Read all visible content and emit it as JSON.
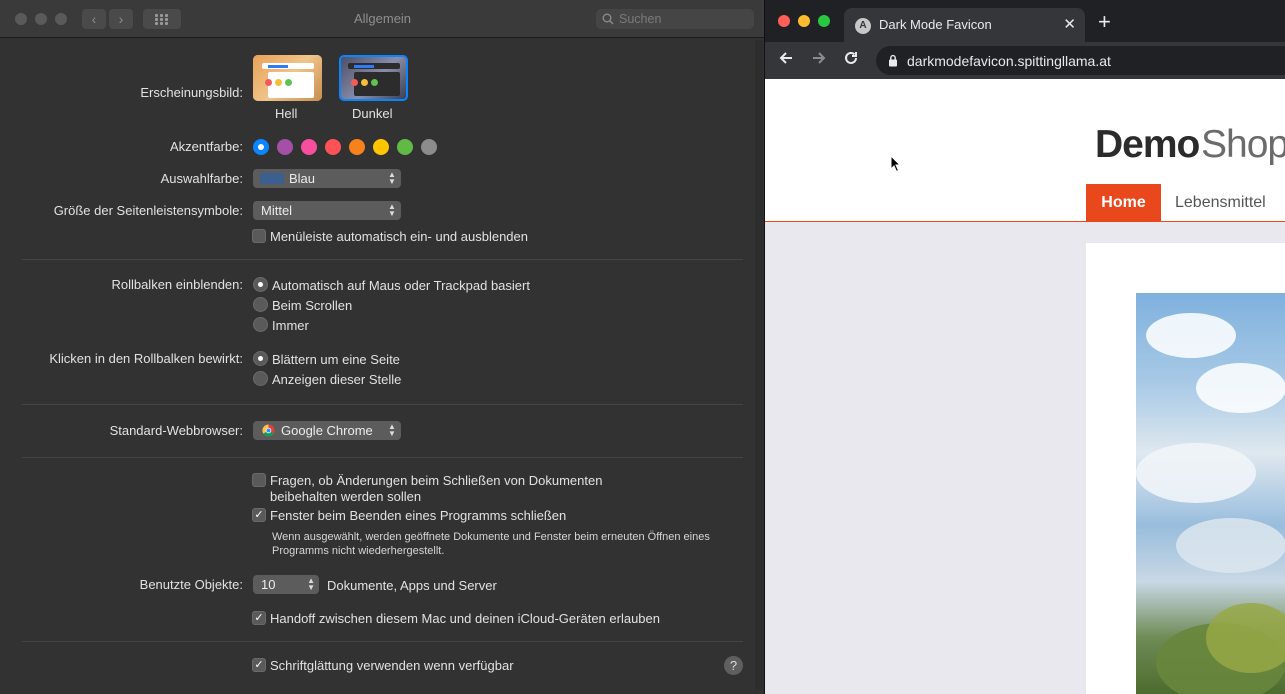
{
  "prefs": {
    "title": "Allgemein",
    "search_placeholder": "Suchen",
    "appearance_label": "Erscheinungsbild:",
    "appearance_options": [
      "Hell",
      "Dunkel"
    ],
    "appearance_selected": "Dunkel",
    "accent_label": "Akzentfarbe:",
    "accent_colors": [
      "#0a84ff",
      "#a550a7",
      "#f74f9e",
      "#ff5257",
      "#f7821b",
      "#ffc600",
      "#62ba46",
      "#8c8c8c"
    ],
    "highlight_label": "Auswahlfarbe:",
    "highlight_value": "Blau",
    "highlight_swatch": "#3b5f8f",
    "sidebar_label": "Größe der Seitenleistensymbole:",
    "sidebar_value": "Mittel",
    "menubar_label": "Menüleiste automatisch ein- und ausblenden",
    "scrollbars_label": "Rollbalken einblenden:",
    "scrollbars_options": [
      "Automatisch auf Maus oder Trackpad basiert",
      "Beim Scrollen",
      "Immer"
    ],
    "scrollbars_selected": "Automatisch auf Maus oder Trackpad basiert",
    "click_label": "Klicken in den Rollbalken bewirkt:",
    "click_options": [
      "Blättern um eine Seite",
      "Anzeigen dieser Stelle"
    ],
    "click_selected": "Blättern um eine Seite",
    "browser_label": "Standard-Webbrowser:",
    "browser_value": "Google Chrome",
    "ask_keep_line1": "Fragen, ob Änderungen beim Schließen von Dokumenten",
    "ask_keep_line2": "beibehalten werden sollen",
    "close_windows_label": "Fenster beim Beenden eines Programms schließen",
    "close_windows_note": "Wenn ausgewählt, werden geöffnete Dokumente und Fenster beim erneuten Öffnen eines Programms nicht wiederhergestellt.",
    "recent_label": "Benutzte Objekte:",
    "recent_value": "10",
    "recent_suffix": "Dokumente, Apps und Server",
    "handoff_label": "Handoff zwischen diesem Mac und deinen iCloud-Geräten erlauben",
    "font_smoothing_label": "Schriftglättung verwenden wenn verfügbar",
    "help": "?"
  },
  "browser": {
    "tab_title": "Dark Mode Favicon",
    "favicon_letter": "A",
    "url": "darkmodefavicon.spittingllama.at",
    "logo_part1": "Demo",
    "logo_part2": "Shop",
    "nav_home": "Home",
    "nav_item": "Lebensmittel",
    "accent": "#e8481b"
  }
}
